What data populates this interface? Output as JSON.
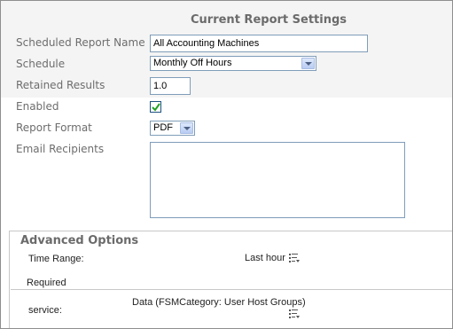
{
  "section_title": "Current Report Settings",
  "fields": {
    "report_name": {
      "label": "Scheduled Report Name",
      "value": "All Accounting Machines"
    },
    "schedule": {
      "label": "Schedule",
      "value": "Monthly Off Hours"
    },
    "retained": {
      "label": "Retained Results",
      "value": "1.0"
    },
    "enabled": {
      "label": "Enabled",
      "checked": true
    },
    "format": {
      "label": "Report Format",
      "value": "PDF"
    },
    "recipients": {
      "label": "Email Recipients",
      "value": ""
    }
  },
  "advanced": {
    "title": "Advanced Options",
    "time_range_label": "Time Range:",
    "time_range_value": "Last hour",
    "required_label": "Required",
    "service_label": "service:",
    "service_value": "Data (FSMCategory: User Host Groups)"
  },
  "colors": {
    "input_border": "#7f9db9",
    "check_color": "#21a121",
    "top_band": "#f4f4f4"
  }
}
